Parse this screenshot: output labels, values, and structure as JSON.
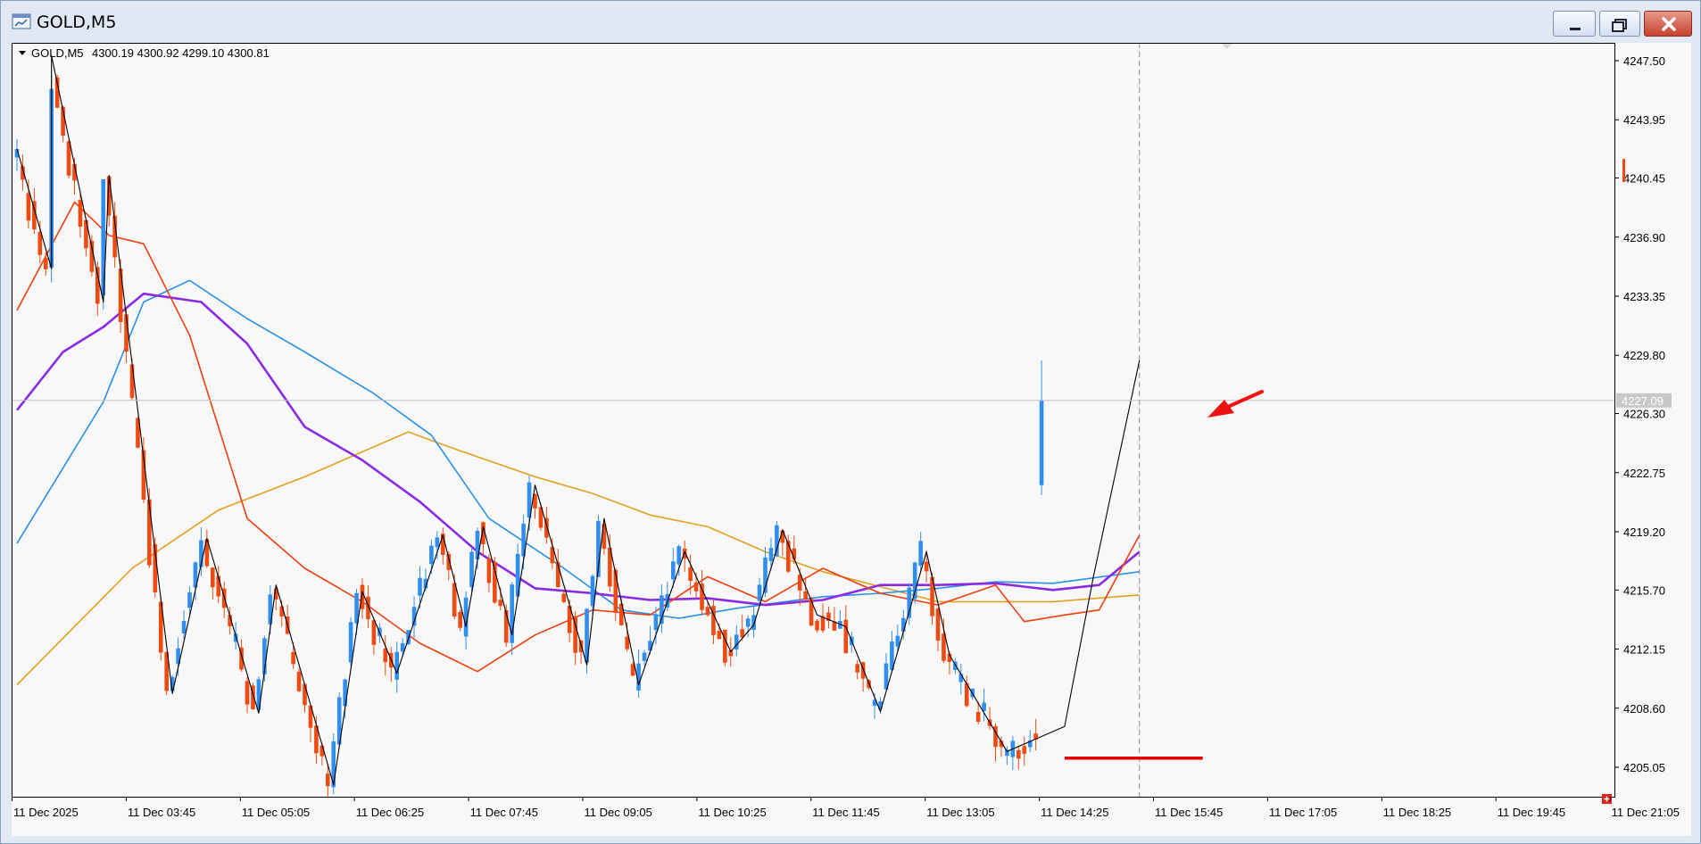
{
  "window": {
    "title": "GOLD,M5",
    "minimize_label": "minimize",
    "maximize_label": "maximize",
    "close_label": "close"
  },
  "chart_header": {
    "symbol": "GOLD,M5",
    "ohlc": "4300.19 4300.92 4299.10 4300.81"
  },
  "colors": {
    "background": "#f8f8f8",
    "bull": "#2f8ef0",
    "bear": "#f04a10",
    "ma_fast": "#f03e10",
    "ma_purple": "#8a2be2",
    "ma_blue": "#2a90e6",
    "ma_gold": "#e0a020",
    "zigzag": "#000000",
    "support_line": "#e00000",
    "arrow": "#ee1111",
    "current_price_tag": "#c8c8c8"
  },
  "chart_data": {
    "type": "candlestick",
    "y_ticks": [
      "4247.50",
      "4243.95",
      "4240.45",
      "4236.90",
      "4233.35",
      "4229.80",
      "4226.30",
      "4222.75",
      "4219.20",
      "4215.70",
      "4212.15",
      "4208.60",
      "4205.05"
    ],
    "current_price_label": "4227.09",
    "current_price": 4227.09,
    "ylim": [
      4203.5,
      4250.0
    ],
    "x_ticks": [
      "11 Dec 2025",
      "11 Dec 03:45",
      "11 Dec 05:05",
      "11 Dec 06:25",
      "11 Dec 07:45",
      "11 Dec 09:05",
      "11 Dec 10:25",
      "11 Dec 11:45",
      "11 Dec 13:05",
      "11 Dec 14:25",
      "11 Dec 15:45",
      "11 Dec 17:05",
      "11 Dec 18:25",
      "11 Dec 19:45",
      "11 Dec 21:05"
    ],
    "num_bars": 178,
    "zigzag": [
      [
        0,
        4242.2
      ],
      [
        6,
        4235.0
      ],
      [
        6,
        4247.8
      ],
      [
        15,
        4233.0
      ],
      [
        16,
        4240.6
      ],
      [
        27,
        4209.5
      ],
      [
        33,
        4218.8
      ],
      [
        42,
        4208.3
      ],
      [
        45,
        4216.0
      ],
      [
        55,
        4204.0
      ],
      [
        60,
        4215.6
      ],
      [
        66,
        4210.7
      ],
      [
        74,
        4219.0
      ],
      [
        78,
        4213.5
      ],
      [
        81,
        4219.5
      ],
      [
        86,
        4213.0
      ],
      [
        90,
        4222.0
      ],
      [
        99,
        4211.2
      ],
      [
        102,
        4220.0
      ],
      [
        108,
        4210.0
      ],
      [
        116,
        4218.0
      ],
      [
        124,
        4212.0
      ],
      [
        128,
        4213.6
      ],
      [
        133,
        4219.3
      ],
      [
        139,
        4214.2
      ],
      [
        144,
        4213.5
      ],
      [
        150,
        4208.4
      ],
      [
        158,
        4218.0
      ],
      [
        162,
        4211.8
      ],
      [
        172,
        4206.0
      ],
      [
        182,
        4207.5
      ],
      [
        187,
        4216.5
      ],
      [
        195,
        4229.5
      ]
    ],
    "support_line": {
      "price": 4205.6,
      "from_bar": 182,
      "to_bar": 206
    },
    "vline_bar": 195,
    "series": [
      {
        "key": "ma_gold",
        "values": [
          [
            0,
            4210.0
          ],
          [
            20,
            4217.0
          ],
          [
            35,
            4220.5
          ],
          [
            50,
            4222.5
          ],
          [
            62,
            4224.3
          ],
          [
            68,
            4225.2
          ],
          [
            75,
            4224.3
          ],
          [
            90,
            4222.5
          ],
          [
            100,
            4221.5
          ],
          [
            110,
            4220.2
          ],
          [
            120,
            4219.5
          ],
          [
            130,
            4218.0
          ],
          [
            140,
            4216.8
          ],
          [
            150,
            4215.9
          ],
          [
            160,
            4215.0
          ],
          [
            170,
            4215.0
          ],
          [
            180,
            4215.0
          ],
          [
            195,
            4215.4
          ]
        ]
      },
      {
        "key": "ma_blue",
        "values": [
          [
            0,
            4218.5
          ],
          [
            15,
            4227.0
          ],
          [
            22,
            4233.0
          ],
          [
            30,
            4234.3
          ],
          [
            40,
            4232.0
          ],
          [
            50,
            4230.0
          ],
          [
            62,
            4227.5
          ],
          [
            72,
            4225.0
          ],
          [
            82,
            4220.0
          ],
          [
            95,
            4217.0
          ],
          [
            105,
            4214.5
          ],
          [
            115,
            4214.0
          ],
          [
            125,
            4214.6
          ],
          [
            140,
            4215.3
          ],
          [
            150,
            4215.5
          ],
          [
            160,
            4215.8
          ],
          [
            170,
            4216.2
          ],
          [
            180,
            4216.1
          ],
          [
            195,
            4216.8
          ]
        ]
      },
      {
        "key": "ma_purple",
        "values": [
          [
            0,
            4226.5
          ],
          [
            8,
            4230.0
          ],
          [
            15,
            4231.5
          ],
          [
            22,
            4233.5
          ],
          [
            32,
            4233.0
          ],
          [
            40,
            4230.5
          ],
          [
            50,
            4225.5
          ],
          [
            60,
            4223.5
          ],
          [
            70,
            4221.0
          ],
          [
            80,
            4218.0
          ],
          [
            90,
            4215.8
          ],
          [
            100,
            4215.5
          ],
          [
            110,
            4215.1
          ],
          [
            120,
            4215.2
          ],
          [
            130,
            4214.8
          ],
          [
            140,
            4215.1
          ],
          [
            150,
            4216.0
          ],
          [
            160,
            4216.0
          ],
          [
            170,
            4216.1
          ],
          [
            180,
            4215.7
          ],
          [
            188,
            4216.0
          ],
          [
            195,
            4218.0
          ]
        ]
      },
      {
        "key": "ma_fast",
        "values": [
          [
            0,
            4232.5
          ],
          [
            10,
            4239.0
          ],
          [
            16,
            4237.0
          ],
          [
            22,
            4236.5
          ],
          [
            30,
            4231.0
          ],
          [
            40,
            4220.0
          ],
          [
            50,
            4217.0
          ],
          [
            60,
            4215.0
          ],
          [
            70,
            4212.5
          ],
          [
            80,
            4210.8
          ],
          [
            90,
            4213.0
          ],
          [
            100,
            4214.5
          ],
          [
            110,
            4214.2
          ],
          [
            120,
            4216.5
          ],
          [
            130,
            4215.0
          ],
          [
            140,
            4217.0
          ],
          [
            150,
            4215.5
          ],
          [
            160,
            4214.8
          ],
          [
            170,
            4216.0
          ],
          [
            175,
            4213.8
          ],
          [
            182,
            4214.2
          ],
          [
            188,
            4214.5
          ],
          [
            195,
            4219.0
          ]
        ]
      }
    ],
    "arrow_label": "",
    "grid": false
  }
}
